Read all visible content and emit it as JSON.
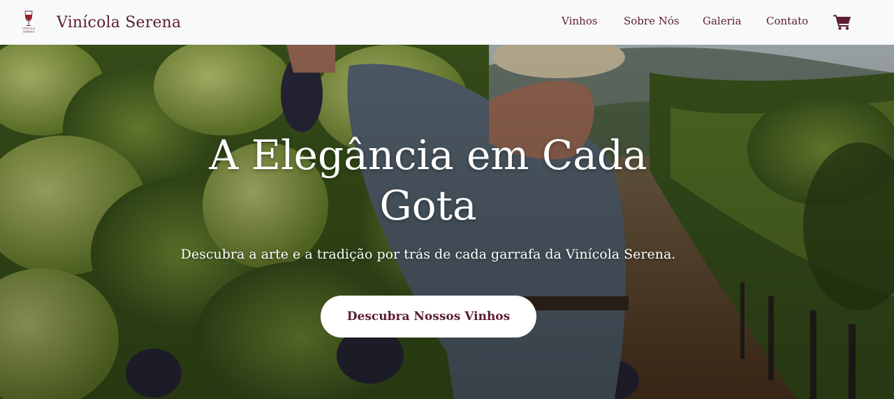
{
  "brand": {
    "logo_icon": "wine-glass-logo-icon",
    "logo_text_lines": [
      "VINÍCOLA",
      "SERENA"
    ],
    "name": "Vinícola Serena"
  },
  "nav": {
    "items": [
      {
        "label": "Vinhos"
      },
      {
        "label": "Sobre Nós"
      },
      {
        "label": "Galeria"
      },
      {
        "label": "Contato"
      }
    ],
    "cart_icon": "shopping-cart-icon"
  },
  "hero": {
    "background": "vineyard-farmer-harvesting-grapes-photo",
    "title": "A Elegância em Cada Gota",
    "subtitle": "Descubra a arte e a tradição por trás de cada garrafa da Vinícola Serena.",
    "cta_label": "Descubra Nossos Vinhos"
  },
  "colors": {
    "navbar_bg": "#f8f9fb",
    "brand_wine": "#5c1d30",
    "hero_text": "#ffffff",
    "button_bg": "#ffffff"
  }
}
